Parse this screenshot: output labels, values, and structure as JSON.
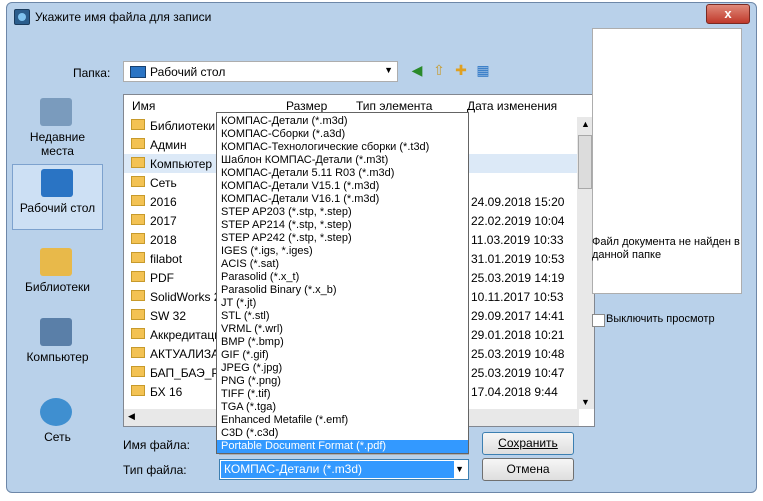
{
  "window": {
    "title": "Укажите имя файла для записи",
    "close_label": "x"
  },
  "folder": {
    "label": "Папка:",
    "value": "Рабочий стол"
  },
  "places": [
    {
      "label": "Недавние места"
    },
    {
      "label": "Рабочий стол"
    },
    {
      "label": "Библиотеки"
    },
    {
      "label": "Компьютер"
    },
    {
      "label": "Сеть"
    }
  ],
  "columns": {
    "name": "Имя",
    "size": "Размер",
    "type": "Тип элемента",
    "date": "Дата изменения"
  },
  "files": [
    {
      "name": "Библиотеки",
      "date": ""
    },
    {
      "name": "Админ",
      "date": ""
    },
    {
      "name": "Компьютер",
      "date": ""
    },
    {
      "name": "Сеть",
      "date": ""
    },
    {
      "name": "2016",
      "date": "24.09.2018 15:20"
    },
    {
      "name": "2017",
      "date": "22.02.2019 10:04"
    },
    {
      "name": "2018",
      "date": "11.03.2019 10:33"
    },
    {
      "name": "filabot",
      "date": "31.01.2019 10:53"
    },
    {
      "name": "PDF",
      "date": "25.03.2019 14:19"
    },
    {
      "name": "SolidWorks 2",
      "date": "10.11.2017 10:53"
    },
    {
      "name": "SW 32",
      "date": "29.09.2017 14:41"
    },
    {
      "name": "Аккредитаци",
      "date": "29.01.2018 10:21"
    },
    {
      "name": "АКТУАЛИЗА",
      "date": "25.03.2019 10:48"
    },
    {
      "name": "БАП_БАЭ_PD",
      "date": "25.03.2019 10:47"
    },
    {
      "name": "БХ 16",
      "date": "17.04.2018 9:44"
    }
  ],
  "file_types": [
    "КОМПАС-Детали (*.m3d)",
    "КОМПАС-Сборки (*.a3d)",
    "КОМПАС-Технологические сборки (*.t3d)",
    "Шаблон КОМПАС-Детали (*.m3t)",
    "КОМПАС-Детали 5.11 R03 (*.m3d)",
    "КОМПАС-Детали V15.1 (*.m3d)",
    "КОМПАС-Детали V16.1 (*.m3d)",
    "STEP AP203 (*.stp, *.step)",
    "STEP AP214 (*.stp, *.step)",
    "STEP AP242 (*.stp, *.step)",
    "IGES (*.igs, *.iges)",
    "ACIS (*.sat)",
    "Parasolid (*.x_t)",
    "Parasolid Binary (*.x_b)",
    "JT (*.jt)",
    "STL (*.stl)",
    "VRML (*.wrl)",
    "BMP (*.bmp)",
    "GIF (*.gif)",
    "JPEG (*.jpg)",
    "PNG (*.png)",
    "TIFF (*.tif)",
    "TGA (*.tga)",
    "Enhanced Metafile (*.emf)",
    "C3D (*.c3d)",
    "Portable Document Format (*.pdf)"
  ],
  "preview": {
    "message": "Файл документа не найден в данной папке",
    "checkbox_label": "Выключить просмотр"
  },
  "filename": {
    "label": "Имя файла:",
    "value": ""
  },
  "filetype": {
    "label": "Тип файла:",
    "value": "КОМПАС-Детали (*.m3d)"
  },
  "buttons": {
    "save": "Сохранить",
    "cancel": "Отмена"
  },
  "colors": {
    "selection": "#3399ff",
    "title_bg": "#b9d1ea",
    "folder": "#f3c253"
  }
}
